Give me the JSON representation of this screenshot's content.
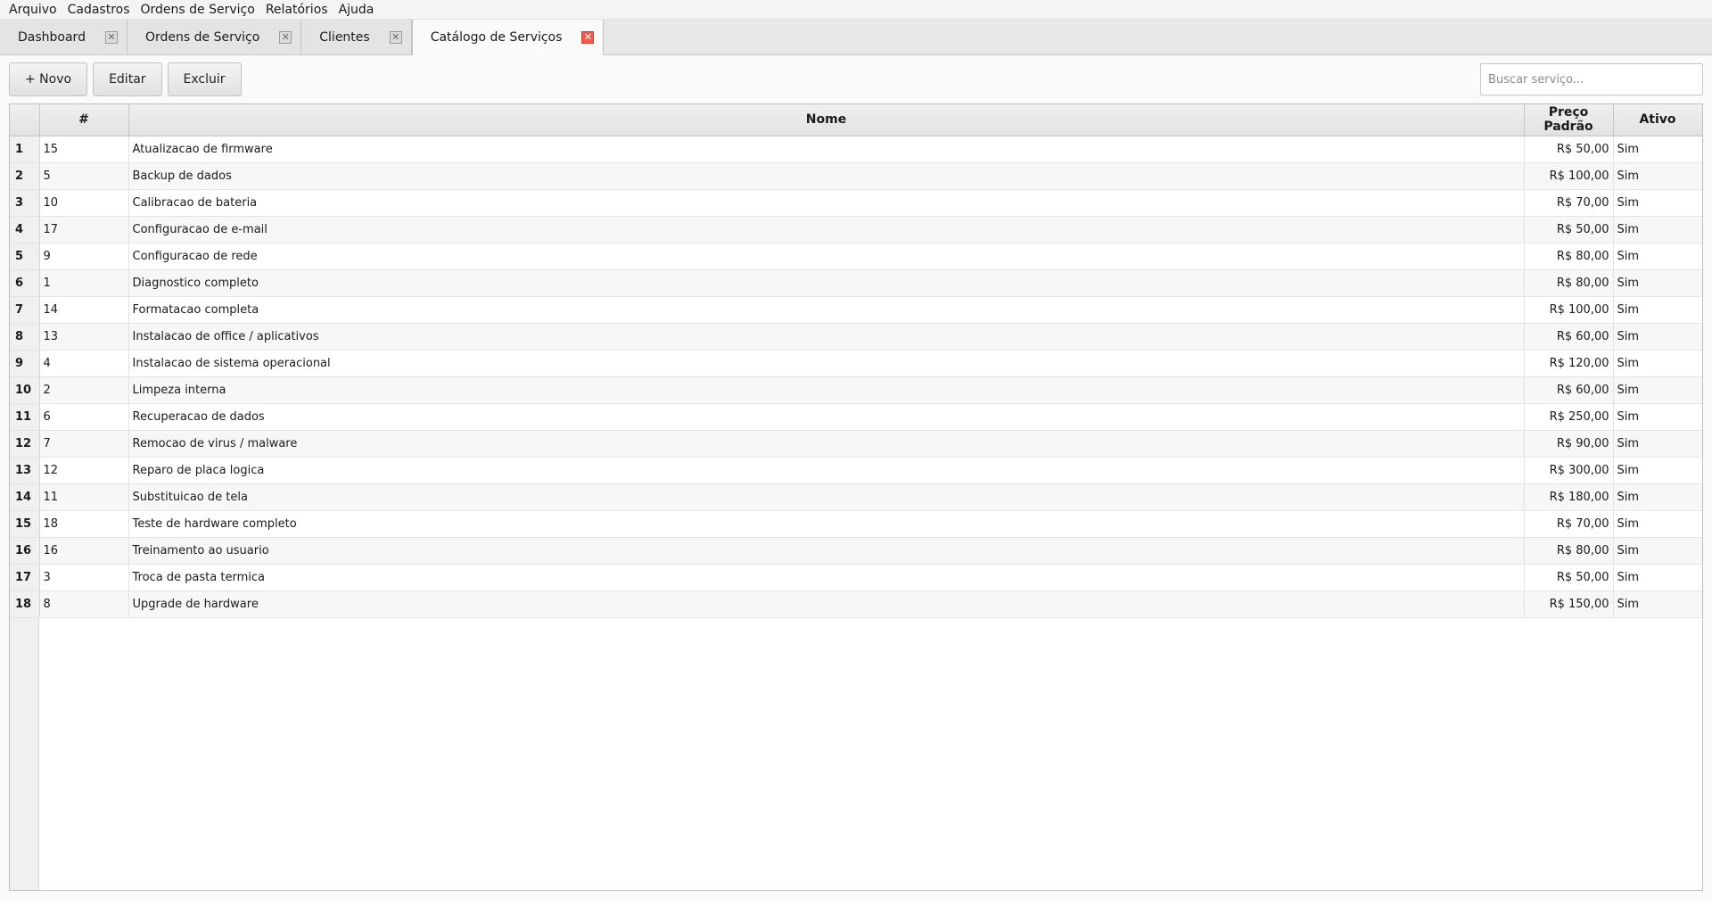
{
  "menu": [
    "Arquivo",
    "Cadastros",
    "Ordens de Serviço",
    "Relatórios",
    "Ajuda"
  ],
  "tabs": [
    {
      "label": "Dashboard",
      "active": false
    },
    {
      "label": "Ordens de Serviço",
      "active": false
    },
    {
      "label": "Clientes",
      "active": false
    },
    {
      "label": "Catálogo de Serviços",
      "active": true
    }
  ],
  "toolbar": {
    "new_label": "+ Novo",
    "edit_label": "Editar",
    "delete_label": "Excluir",
    "search_placeholder": "Buscar serviço..."
  },
  "table": {
    "columns": [
      "#",
      "Nome",
      "Preço Padrão",
      "Ativo"
    ],
    "rows": [
      {
        "n": "1",
        "id": "15",
        "nome": "Atualizacao de firmware",
        "preco": "R$ 50,00",
        "ativo": "Sim"
      },
      {
        "n": "2",
        "id": "5",
        "nome": "Backup de dados",
        "preco": "R$ 100,00",
        "ativo": "Sim"
      },
      {
        "n": "3",
        "id": "10",
        "nome": "Calibracao de bateria",
        "preco": "R$ 70,00",
        "ativo": "Sim"
      },
      {
        "n": "4",
        "id": "17",
        "nome": "Configuracao de e-mail",
        "preco": "R$ 50,00",
        "ativo": "Sim"
      },
      {
        "n": "5",
        "id": "9",
        "nome": "Configuracao de rede",
        "preco": "R$ 80,00",
        "ativo": "Sim"
      },
      {
        "n": "6",
        "id": "1",
        "nome": "Diagnostico completo",
        "preco": "R$ 80,00",
        "ativo": "Sim"
      },
      {
        "n": "7",
        "id": "14",
        "nome": "Formatacao completa",
        "preco": "R$ 100,00",
        "ativo": "Sim"
      },
      {
        "n": "8",
        "id": "13",
        "nome": "Instalacao de office / aplicativos",
        "preco": "R$ 60,00",
        "ativo": "Sim"
      },
      {
        "n": "9",
        "id": "4",
        "nome": "Instalacao de sistema operacional",
        "preco": "R$ 120,00",
        "ativo": "Sim"
      },
      {
        "n": "10",
        "id": "2",
        "nome": "Limpeza interna",
        "preco": "R$ 60,00",
        "ativo": "Sim"
      },
      {
        "n": "11",
        "id": "6",
        "nome": "Recuperacao de dados",
        "preco": "R$ 250,00",
        "ativo": "Sim"
      },
      {
        "n": "12",
        "id": "7",
        "nome": "Remocao de virus / malware",
        "preco": "R$ 90,00",
        "ativo": "Sim"
      },
      {
        "n": "13",
        "id": "12",
        "nome": "Reparo de placa logica",
        "preco": "R$ 300,00",
        "ativo": "Sim"
      },
      {
        "n": "14",
        "id": "11",
        "nome": "Substituicao de tela",
        "preco": "R$ 180,00",
        "ativo": "Sim"
      },
      {
        "n": "15",
        "id": "18",
        "nome": "Teste de hardware completo",
        "preco": "R$ 70,00",
        "ativo": "Sim"
      },
      {
        "n": "16",
        "id": "16",
        "nome": "Treinamento ao usuario",
        "preco": "R$ 80,00",
        "ativo": "Sim"
      },
      {
        "n": "17",
        "id": "3",
        "nome": "Troca de pasta termica",
        "preco": "R$ 50,00",
        "ativo": "Sim"
      },
      {
        "n": "18",
        "id": "8",
        "nome": "Upgrade de hardware",
        "preco": "R$ 150,00",
        "ativo": "Sim"
      }
    ]
  }
}
